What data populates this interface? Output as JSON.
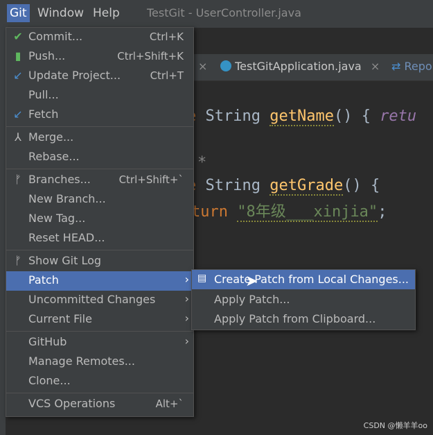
{
  "menubar": {
    "items": [
      "Git",
      "Window",
      "Help"
    ],
    "window_title": "TestGit - UserController.java"
  },
  "tabs": [
    {
      "label": "TestGitApplication.java"
    },
    {
      "label": "Repo"
    }
  ],
  "code": {
    "line1_type": "String",
    "line1_fn": "getName",
    "line1_rest": "() {",
    "line1_kw": "retu",
    "line2_type": "String",
    "line2_fn": "getGrade",
    "line2_rest": "() {",
    "line3_kw": "turn",
    "line3_str": "\"8年级___xinjia\"",
    "line3_end": ";",
    "comment_star": "*",
    "line1_prefix": "e",
    "line2_prefix": "e"
  },
  "git_menu": {
    "items": [
      {
        "label": "Commit...",
        "shortcut": "Ctrl+K",
        "icon": "check-icon"
      },
      {
        "label": "Push...",
        "shortcut": "Ctrl+Shift+K",
        "icon": "push-icon"
      },
      {
        "label": "Update Project...",
        "shortcut": "Ctrl+T",
        "icon": "update-icon"
      },
      {
        "label": "Pull...",
        "shortcut": ""
      },
      {
        "label": "Fetch",
        "shortcut": "",
        "icon": "fetch-icon"
      },
      {
        "label": "Merge...",
        "shortcut": "",
        "icon": "merge-icon"
      },
      {
        "label": "Rebase...",
        "shortcut": ""
      },
      {
        "label": "Branches...",
        "shortcut": "Ctrl+Shift+`",
        "icon": "branch-icon"
      },
      {
        "label": "New Branch...",
        "shortcut": ""
      },
      {
        "label": "New Tag...",
        "shortcut": ""
      },
      {
        "label": "Reset HEAD...",
        "shortcut": ""
      },
      {
        "label": "Show Git Log",
        "shortcut": "",
        "icon": "git-log-icon"
      },
      {
        "label": "Patch",
        "shortcut": "",
        "arrow": "›"
      },
      {
        "label": "Uncommitted Changes",
        "shortcut": "",
        "arrow": "›"
      },
      {
        "label": "Current File",
        "shortcut": "",
        "arrow": "›"
      },
      {
        "label": "GitHub",
        "shortcut": "",
        "arrow": "›"
      },
      {
        "label": "Manage Remotes...",
        "shortcut": ""
      },
      {
        "label": "Clone...",
        "shortcut": ""
      },
      {
        "label": "VCS Operations",
        "shortcut": "Alt+`"
      }
    ]
  },
  "patch_submenu": {
    "items": [
      {
        "label": "Create Patch from Local Changes...",
        "icon": "patch-icon"
      },
      {
        "label": "Apply Patch..."
      },
      {
        "label": "Apply Patch from Clipboard..."
      }
    ]
  },
  "watermark": "CSDN @懒羊羊oo",
  "colors": {
    "accent": "#4b6eaf",
    "menu_bg": "#3c3f41",
    "editor_bg": "#2b2b2b"
  }
}
